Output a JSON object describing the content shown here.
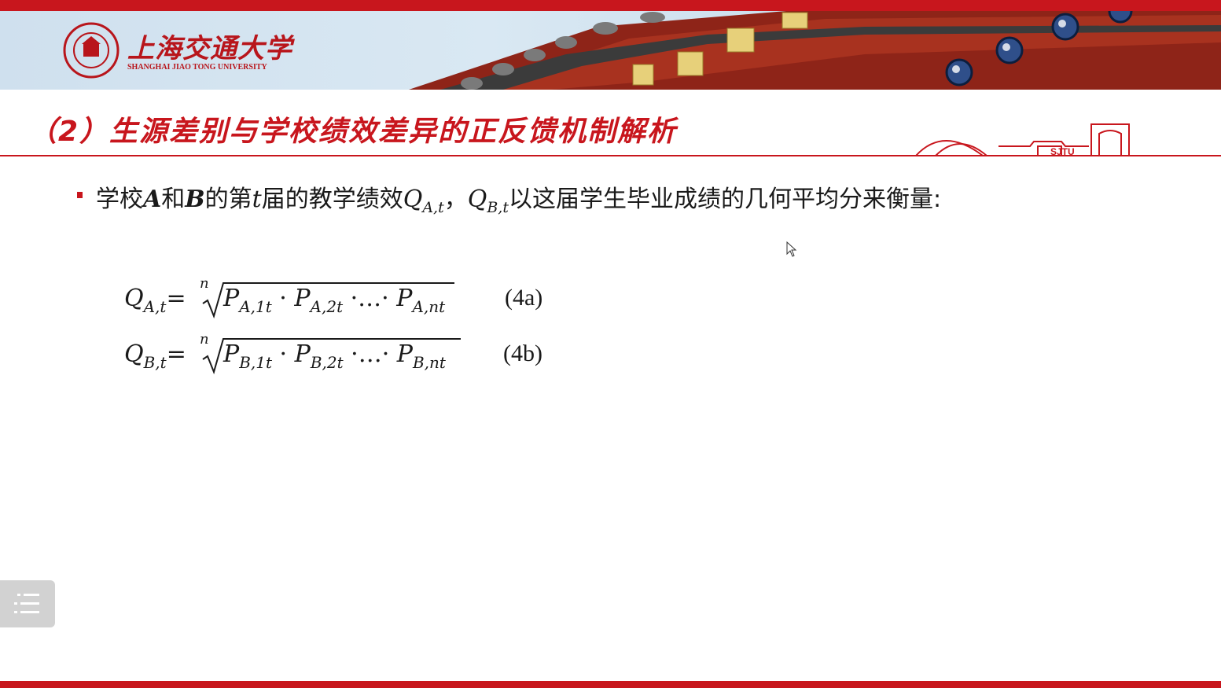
{
  "header": {
    "logo_cn": "上海交通大学",
    "logo_en": "SHANGHAI JIAO TONG UNIVERSITY",
    "deco_text": "SJTU"
  },
  "slide": {
    "title": "（2）生源差别与学校绩效差异的正反馈机制解析",
    "bullet": {
      "p1": "学校",
      "A": "A",
      "p2": "和",
      "B": "B",
      "p3": "的第",
      "t": "t",
      "p4": "届的教学绩效",
      "QAt": "Q",
      "QAt_sub": "A,t",
      "sep": "，",
      "QBt": "Q",
      "QBt_sub": "B,t",
      "p5": "以这届学生毕业成绩的几何平均分来衡量:"
    },
    "equations": [
      {
        "lhs": "Q",
        "lhs_sub": "A,t",
        "eq": "=",
        "index": "n",
        "t1": "P",
        "t1_sub": "A,1t",
        "dot1": " · ",
        "t2": "P",
        "t2_sub": "A,2t",
        "dots": " ·…· ",
        "t3": "P",
        "t3_sub": "A,nt",
        "number": "(4a)"
      },
      {
        "lhs": "Q",
        "lhs_sub": "B,t",
        "eq": "=",
        "index": "n",
        "t1": "P",
        "t1_sub": "B,1t",
        "dot1": " · ",
        "t2": "P",
        "t2_sub": "B,2t",
        "dots": " ·…· ",
        "t3": "P",
        "t3_sub": "B,nt",
        "number": "(4b)"
      }
    ]
  },
  "colors": {
    "accent": "#c8161d",
    "text": "#1a1a1a",
    "menu_bg": "#d2d2d2"
  },
  "icons": {
    "menu": "list-menu-icon",
    "cursor": "mouse-pointer-icon"
  }
}
